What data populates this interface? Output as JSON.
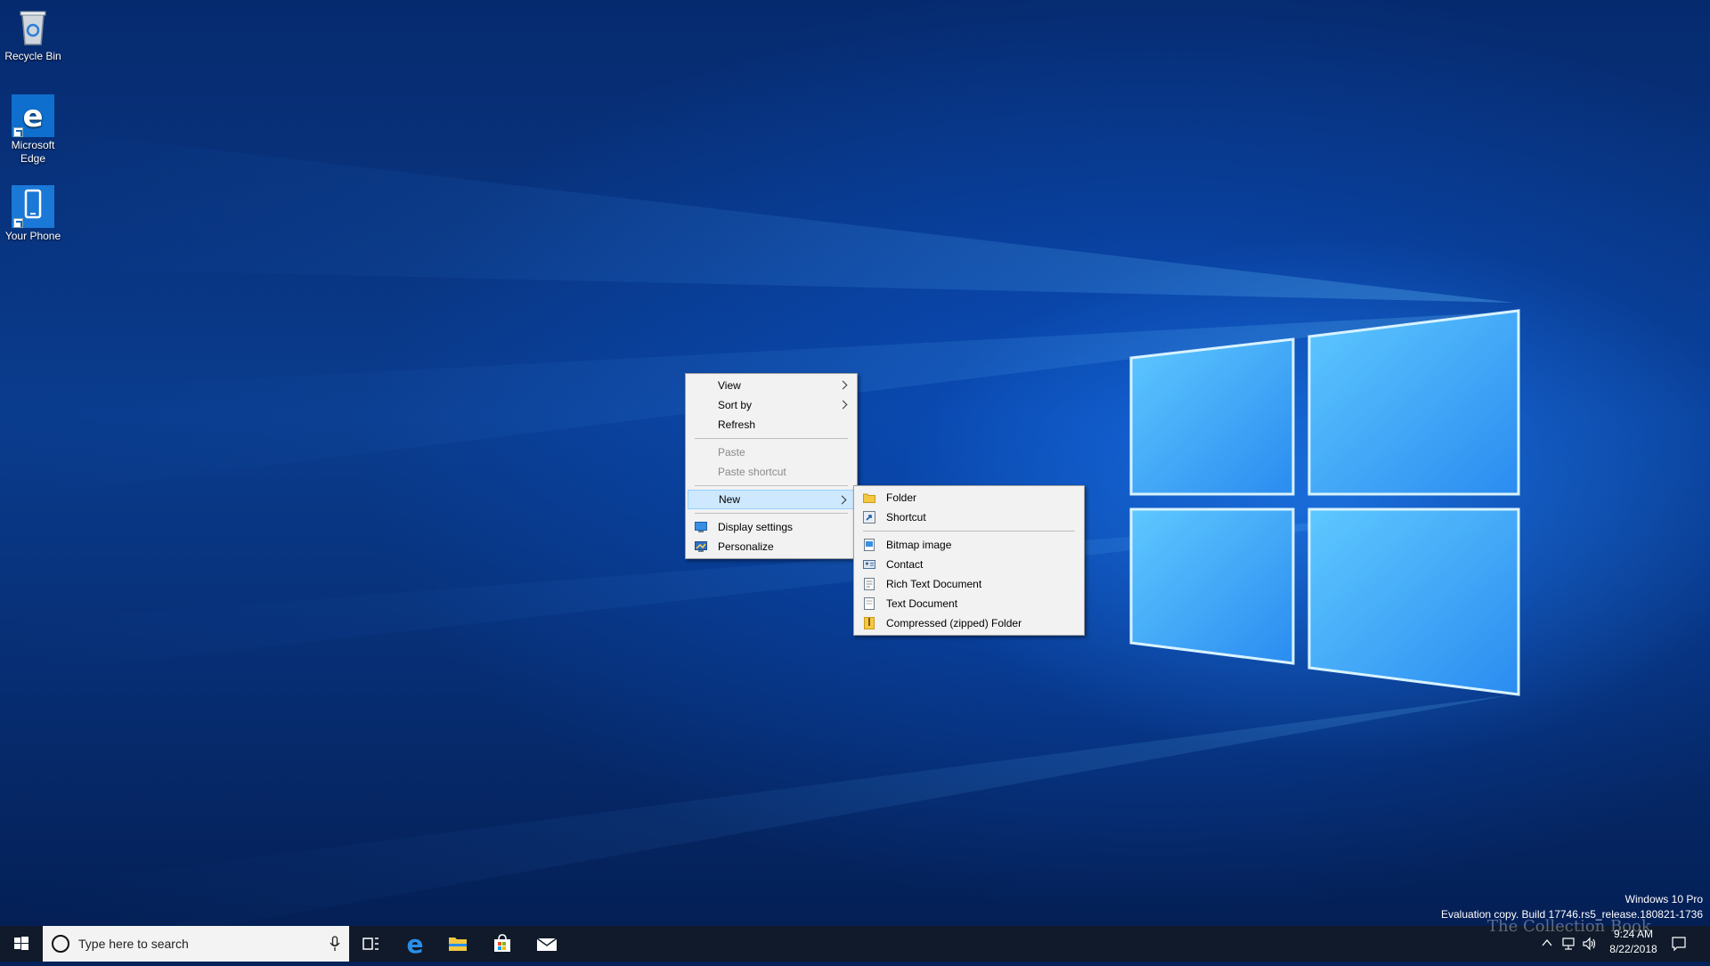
{
  "desktop_icons": [
    {
      "label": "Recycle Bin",
      "icon": "recycle-bin-icon"
    },
    {
      "label": "Microsoft Edge",
      "icon": "edge-icon"
    },
    {
      "label": "Your Phone",
      "icon": "phone-icon"
    }
  ],
  "context_menu": {
    "items": [
      {
        "label": "View",
        "submenu": true
      },
      {
        "label": "Sort by",
        "submenu": true
      },
      {
        "label": "Refresh"
      },
      {
        "label": "Paste",
        "disabled": true
      },
      {
        "label": "Paste shortcut",
        "disabled": true
      },
      {
        "label": "New",
        "submenu": true,
        "highlighted": true
      },
      {
        "label": "Display settings",
        "icon": "display-settings-icon"
      },
      {
        "label": "Personalize",
        "icon": "personalize-icon"
      }
    ]
  },
  "new_submenu": {
    "items": [
      {
        "label": "Folder",
        "icon": "folder-icon"
      },
      {
        "label": "Shortcut",
        "icon": "shortcut-icon"
      },
      {
        "label": "Bitmap image",
        "icon": "bitmap-icon"
      },
      {
        "label": "Contact",
        "icon": "contact-icon"
      },
      {
        "label": "Rich Text Document",
        "icon": "rich-text-icon"
      },
      {
        "label": "Text Document",
        "icon": "text-document-icon"
      },
      {
        "label": "Compressed (zipped) Folder",
        "icon": "zip-folder-icon"
      }
    ]
  },
  "taskbar": {
    "search_placeholder": "Type here to search",
    "pinned": [
      "task-view-icon",
      "edge-icon",
      "file-explorer-icon",
      "store-icon",
      "mail-icon"
    ]
  },
  "watermark": {
    "line1": "Windows 10 Pro",
    "line2": "Evaluation copy. Build 17746.rs5_release.180821-1736"
  },
  "overlay_text": "The Collection Book",
  "clock": {
    "time": "9:24 AM",
    "date": "8/22/2018"
  },
  "colors": {
    "menu_bg": "#f2f2f2",
    "highlight": "#cde8ff",
    "taskbar": "#101a2a",
    "accent": "#0078d7"
  }
}
